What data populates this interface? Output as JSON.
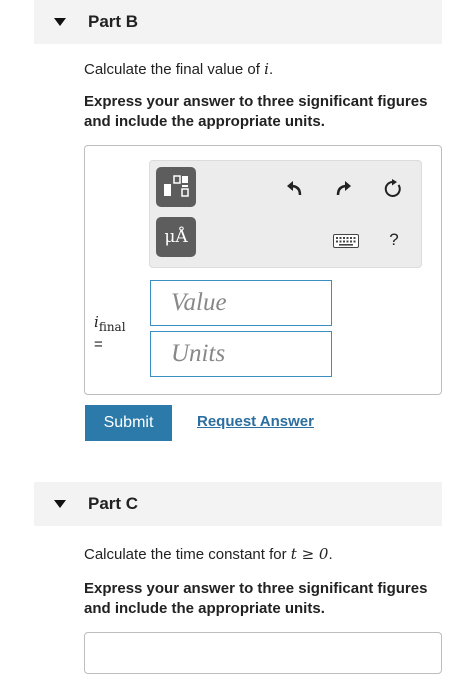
{
  "partB": {
    "title": "Part B",
    "question_prefix": "Calculate the final value of ",
    "question_var": "i",
    "question_suffix": ".",
    "instruction": "Express your answer to three significant figures and include the appropriate units."
  },
  "toolbar": {
    "units_button": "μÅ",
    "help": "?",
    "icons": [
      "templates-icon",
      "undo-icon",
      "redo-icon",
      "reset-icon",
      "keyboard-icon"
    ]
  },
  "answer": {
    "var_main": "i",
    "var_sub": "final",
    "equals": "=",
    "value_placeholder": "Value",
    "units_placeholder": "Units"
  },
  "actions": {
    "submit": "Submit",
    "request": "Request Answer"
  },
  "partC": {
    "title": "Part C",
    "question_prefix": "Calculate the time constant for ",
    "question_math": "t ≥ 0",
    "question_suffix": ".",
    "instruction": "Express your answer to three significant figures and include the appropriate units."
  },
  "colors": {
    "submit_bg": "#2b7aa9",
    "link": "#2b6ea0",
    "field_border": "#3a8fc0"
  }
}
